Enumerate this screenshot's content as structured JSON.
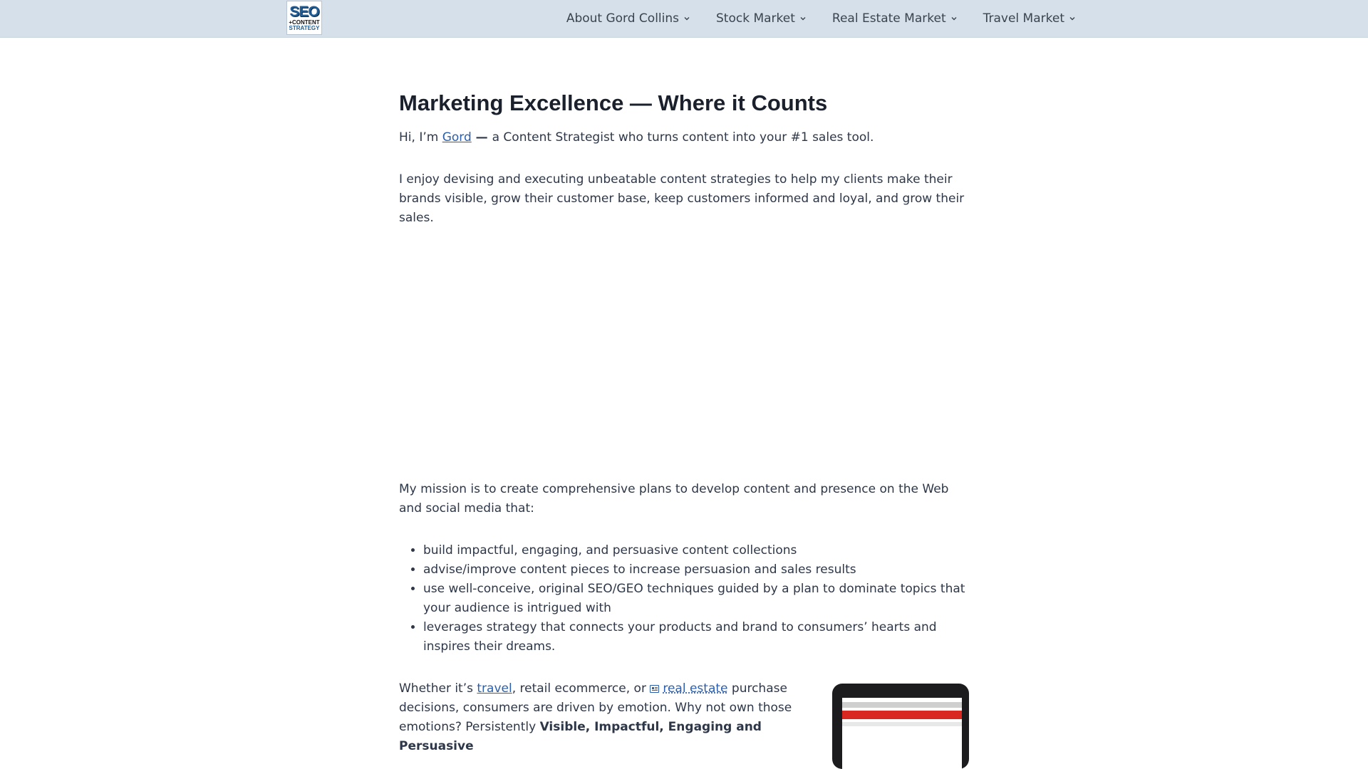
{
  "header": {
    "logo": {
      "line1": "SEO",
      "line2": "+CONTENT",
      "line3": "STRATEGY"
    },
    "nav": [
      {
        "label": "About Gord Collins"
      },
      {
        "label": "Stock Market"
      },
      {
        "label": "Real Estate Market"
      },
      {
        "label": "Travel Market"
      }
    ]
  },
  "main": {
    "title": "Marketing Excellence — Where it Counts",
    "intro": {
      "prefix": "Hi, I’m ",
      "link": "Gord",
      "dash": " — ",
      "suffix": "a Content Strategist who turns content into your #1 sales tool."
    },
    "para2": "I enjoy devising and executing unbeatable content strategies to help my clients make their brands visible, grow their customer base, keep customers informed and loyal, and grow their sales.",
    "mission": "My mission is to create comprehensive plans to develop content and presence on the Web and social media that:",
    "bullets": [
      "build impactful, engaging, and persuasive content collections",
      "advise/improve content pieces to increase persuasion and sales results",
      "use well-conceive, original SEO/GEO techniques guided by a plan to dominate topics that your audience is intrigued with",
      "leverages strategy that connects your products and brand to consumers’ hearts and inspires their dreams."
    ],
    "closing": {
      "t1": "Whether it’s ",
      "link_travel": "travel",
      "t2": ", retail ecommerce, or ",
      "link_realestate": "real estate",
      "t3": " purchase decisions, consumers are driven by emotion.  Why not own those emotions?  Persistently ",
      "bold": "Visible, Impactful, Engaging and Persuasive"
    }
  },
  "colors": {
    "header_bg": "#d6e0ea",
    "link": "#2b5fad",
    "text": "#2d3748",
    "heading": "#1a202c"
  }
}
